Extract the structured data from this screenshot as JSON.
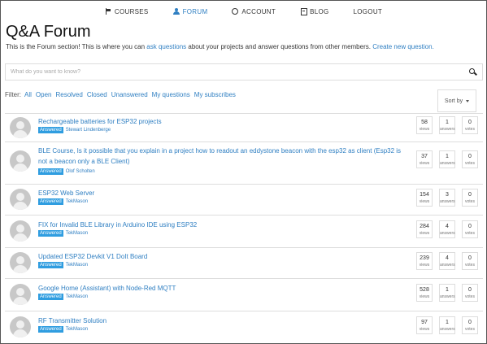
{
  "nav": [
    {
      "label": "COURSES",
      "icon": "flag-icon",
      "active": false
    },
    {
      "label": "FORUM",
      "icon": "user-icon",
      "active": true
    },
    {
      "label": "ACCOUNT",
      "icon": "gear-icon",
      "active": false
    },
    {
      "label": "BLOG",
      "icon": "book-icon",
      "active": false
    },
    {
      "label": "LOGOUT",
      "icon": "",
      "active": false
    }
  ],
  "page": {
    "title": "Q&A Forum",
    "intro_pre": "This is the Forum section! This is where you can ",
    "intro_link1": "ask questions",
    "intro_mid": " about your projects and answer questions from other members. ",
    "intro_link2": "Create new question."
  },
  "search": {
    "placeholder": "What do you want to know?"
  },
  "filter": {
    "label": "Filter:",
    "items": [
      "All",
      "Open",
      "Resolved",
      "Closed",
      "Unanswered",
      "My questions",
      "My subscribes"
    ]
  },
  "sort": {
    "label": "Sort by"
  },
  "stat_labels": {
    "views": "views",
    "answers": "answers",
    "votes": "votes"
  },
  "questions": [
    {
      "title": "Rechargeable batteries for ESP32 projects",
      "status": "Answered",
      "author": "Stewart Lindenberge",
      "views": "58",
      "answers": "1",
      "votes": "0"
    },
    {
      "title": "BLE Course, Is it possible that you explain in a project how to readout an eddystone beacon with the esp32 as client (Esp32 is not a beacon only a BLE Client)",
      "status": "Answered",
      "author": "Olof Scholten",
      "views": "37",
      "answers": "1",
      "votes": "0"
    },
    {
      "title": "ESP32 Web Server",
      "status": "Answered",
      "author": "TekMason",
      "views": "154",
      "answers": "3",
      "votes": "0"
    },
    {
      "title": "FIX for Invalid BLE Library in Arduino IDE using ESP32",
      "status": "Answered",
      "author": "TekMason",
      "views": "284",
      "answers": "4",
      "votes": "0"
    },
    {
      "title": "Updated ESP32 Devkit V1 DoIt Board",
      "status": "Answered",
      "author": "TekMason",
      "views": "239",
      "answers": "4",
      "votes": "0"
    },
    {
      "title": "Google Home (Assistant) with Node-Red MQTT",
      "status": "Answered",
      "author": "TekMason",
      "views": "528",
      "answers": "1",
      "votes": "0"
    },
    {
      "title": "RF Transmitter Solution",
      "status": "Answered",
      "author": "TekMason",
      "views": "97",
      "answers": "1",
      "votes": "0"
    }
  ]
}
